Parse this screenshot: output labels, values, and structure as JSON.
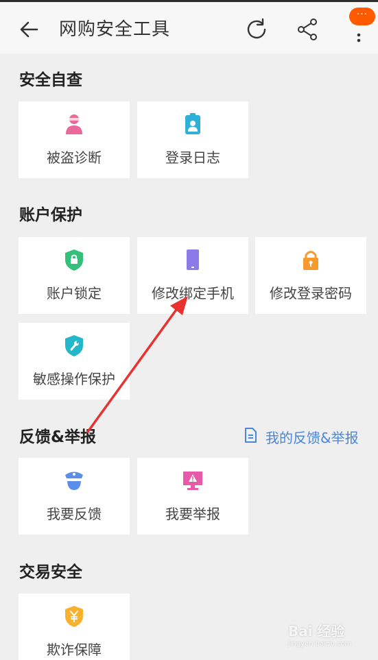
{
  "header": {
    "title": "网购安全工具",
    "more_badge": "···"
  },
  "sections": {
    "self_check": {
      "title": "安全自查",
      "items": [
        {
          "label": "被盗诊断",
          "icon": "person-masked-icon",
          "color": "#e8699a"
        },
        {
          "label": "登录日志",
          "icon": "id-badge-icon",
          "color": "#2fb0d8"
        }
      ]
    },
    "account": {
      "title": "账户保护",
      "items": [
        {
          "label": "账户锁定",
          "icon": "shield-lock-icon",
          "color": "#33c07a"
        },
        {
          "label": "修改绑定手机",
          "icon": "phone-icon",
          "color": "#8b7ae8"
        },
        {
          "label": "修改登录密码",
          "icon": "padlock-icon",
          "color": "#f79a2e"
        },
        {
          "label": "敏感操作保护",
          "icon": "shield-wrench-icon",
          "color": "#22b7c9"
        }
      ]
    },
    "feedback": {
      "title": "反馈&举报",
      "link": "我的反馈&举报",
      "items": [
        {
          "label": "我要反馈",
          "icon": "police-cap-icon",
          "color": "#5a8ee8"
        },
        {
          "label": "我要举报",
          "icon": "warning-monitor-icon",
          "color": "#e85aa8"
        }
      ]
    },
    "trade": {
      "title": "交易安全",
      "items": [
        {
          "label": "欺诈保障",
          "icon": "shield-yuan-icon",
          "color": "#f7b12e"
        }
      ]
    }
  },
  "watermark": {
    "text": "Bai 经验",
    "sub": "jingyan.baidu.com"
  },
  "colors": {
    "accent_orange": "#ff5a00",
    "link_blue": "#4a86d8",
    "annotation_red": "#e8322f"
  }
}
